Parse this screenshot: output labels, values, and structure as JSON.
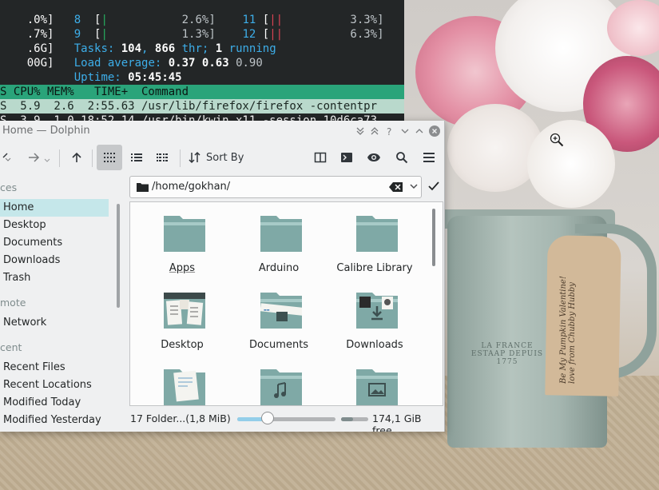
{
  "terminal": {
    "cpu_rows": [
      {
        "left": ".0%]",
        "num1": "8",
        "val1": "2.6%]",
        "num2": "11",
        "val2": "3.3%]"
      },
      {
        "left": ".7%]",
        "num1": "9",
        "val1": "1.3%]",
        "num2": "12",
        "val2": "6.3%]"
      }
    ],
    "mem_left": [
      ".6G]",
      "00G]"
    ],
    "tasks_label": "Tasks: ",
    "tasks_count": "104",
    "tasks_sep": ", ",
    "threads": "866",
    "threads_label": " thr; ",
    "running": "1",
    "running_label": " running",
    "load_label": "Load average: ",
    "load_1": "0.37",
    "load_5": "0.63",
    "load_15": "0.90",
    "uptime_label": "Uptime: ",
    "uptime_value": "05:45:45",
    "header": "S CPU% MEM%   TIME+  Command",
    "proc_rows": [
      "S  5.9  2.6  2:55.63 /usr/lib/firefox/firefox -contentpr",
      "S  3.9  1.0 18:52.14 /usr/bin/kwin_x11 -session 10d6ca73"
    ]
  },
  "dolphin": {
    "title": "Home — Dolphin",
    "toolbar": {
      "sort_label": "Sort By"
    },
    "sidebar": {
      "places_header": "ces",
      "places": [
        "Home",
        "Desktop",
        "Documents",
        "Downloads",
        "Trash"
      ],
      "remote_header": "mote",
      "remote": [
        "Network"
      ],
      "recent_header": "cent",
      "recent": [
        "Recent Files",
        "Recent Locations",
        "Modified Today",
        "Modified Yesterday"
      ]
    },
    "path": "/home/gokhan/",
    "files": [
      {
        "name": "Apps",
        "icon": "folder-icon"
      },
      {
        "name": "Arduino",
        "icon": "folder-icon"
      },
      {
        "name": "Calibre Library",
        "icon": "folder-icon"
      },
      {
        "name": "Desktop",
        "icon": "folder-desktop-icon"
      },
      {
        "name": "Documents",
        "icon": "folder-documents-icon"
      },
      {
        "name": "Downloads",
        "icon": "folder-downloads-icon"
      },
      {
        "name": "",
        "icon": "folder-templates-icon"
      },
      {
        "name": "",
        "icon": "folder-music-icon"
      },
      {
        "name": "",
        "icon": "folder-pictures-icon"
      }
    ],
    "status": {
      "summary": "17 Folder...(1,8 MiB)",
      "zoom_level": 0.28,
      "disk_used_fraction": 0.45,
      "free_space": "174,1 GiB free"
    },
    "colors": {
      "folder": "#7fa9a6",
      "folder_tab": "#9ec3c0",
      "selection": "#c5e7ea",
      "accent": "#3daee9"
    }
  },
  "wallpaper": {
    "can_text": "LA FRANCE ESTAAP DEPUIS 1775",
    "tag_text": "Be My Pumpkin Valentine! love from Chubby Hubby"
  }
}
